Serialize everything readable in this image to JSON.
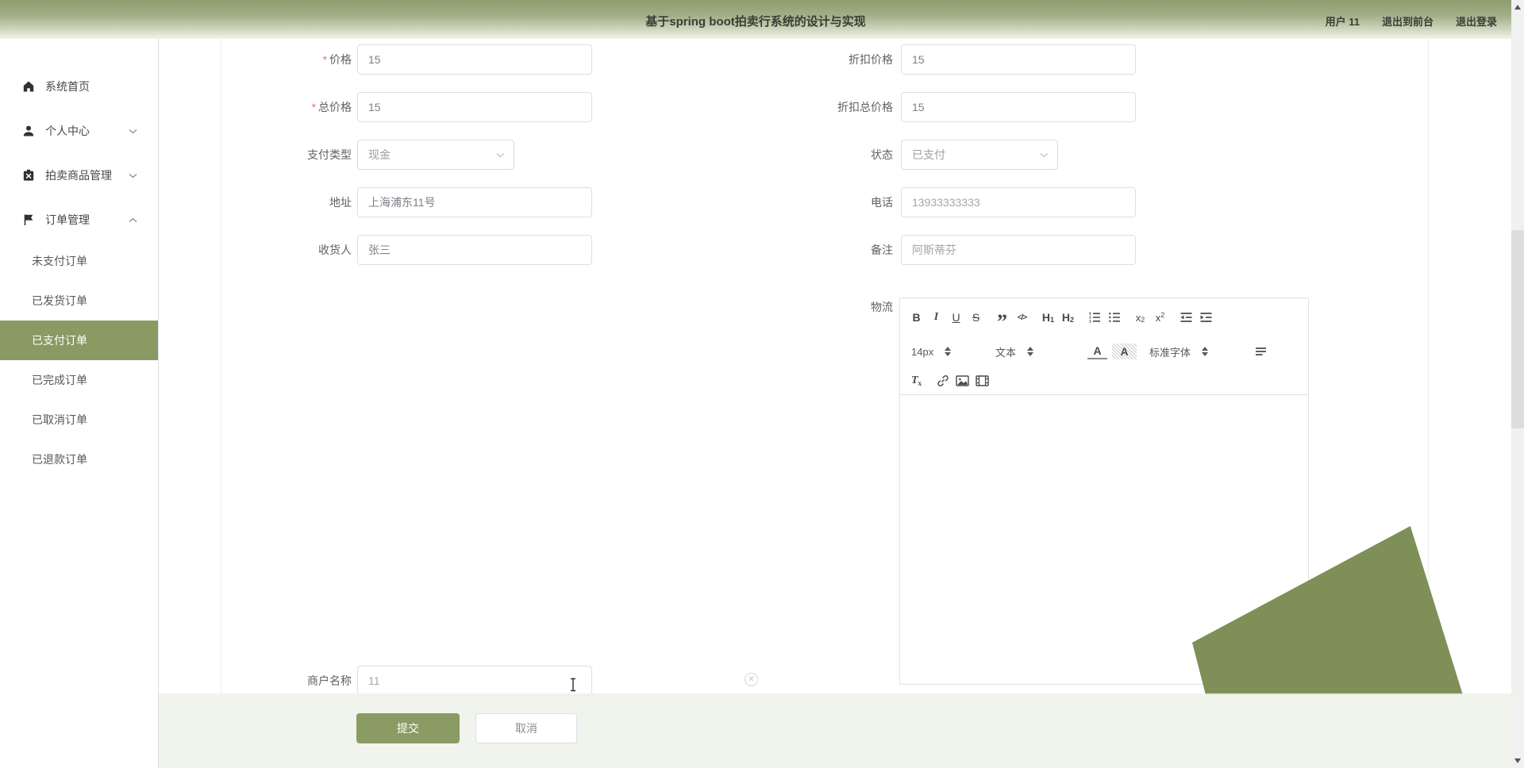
{
  "header": {
    "title": "基于spring boot拍卖行系统的设计与实现",
    "links": {
      "user": "用户 11",
      "to_front": "退出到前台",
      "logout": "退出登录"
    }
  },
  "sidebar": {
    "items": [
      {
        "label": "系统首页"
      },
      {
        "label": "个人中心"
      },
      {
        "label": "拍卖商品管理"
      },
      {
        "label": "订单管理"
      }
    ],
    "order_submenu": [
      {
        "label": "未支付订单"
      },
      {
        "label": "已发货订单"
      },
      {
        "label": "已支付订单"
      },
      {
        "label": "已完成订单"
      },
      {
        "label": "已取消订单"
      },
      {
        "label": "已退款订单"
      }
    ],
    "active_item": "已支付订单"
  },
  "form": {
    "left": [
      {
        "label": "价格",
        "value": "15",
        "required": true
      },
      {
        "label": "总价格",
        "value": "15",
        "required": true
      },
      {
        "label": "支付类型",
        "value": "现金"
      },
      {
        "label": "地址",
        "value": "上海浦东11号"
      },
      {
        "label": "收货人",
        "value": "张三"
      }
    ],
    "right": [
      {
        "label": "折扣价格",
        "value": "15"
      },
      {
        "label": "折扣总价格",
        "value": "15"
      },
      {
        "label": "状态",
        "value": "已支付"
      },
      {
        "label": "电话",
        "value": "13933333333"
      },
      {
        "label": "备注",
        "value": "阿斯蒂芬"
      }
    ],
    "logistics": {
      "label": "物流"
    },
    "merchant": {
      "label": "商户名称",
      "value": "11"
    }
  },
  "editor": {
    "font_size": "14px",
    "paragraph_format": "文本",
    "font_family": "标准字体"
  },
  "footer": {
    "submit": "提交",
    "cancel": "取消"
  },
  "colors": {
    "accent": "#8A9B64",
    "active_menu_bg": "#8A9A63",
    "shape": "#7E9057",
    "topbar_top": "#8D9D6E",
    "topbar_bottom": "#F2F4EC",
    "required": "#F56C6C",
    "input_border": "#DCDFE6"
  }
}
